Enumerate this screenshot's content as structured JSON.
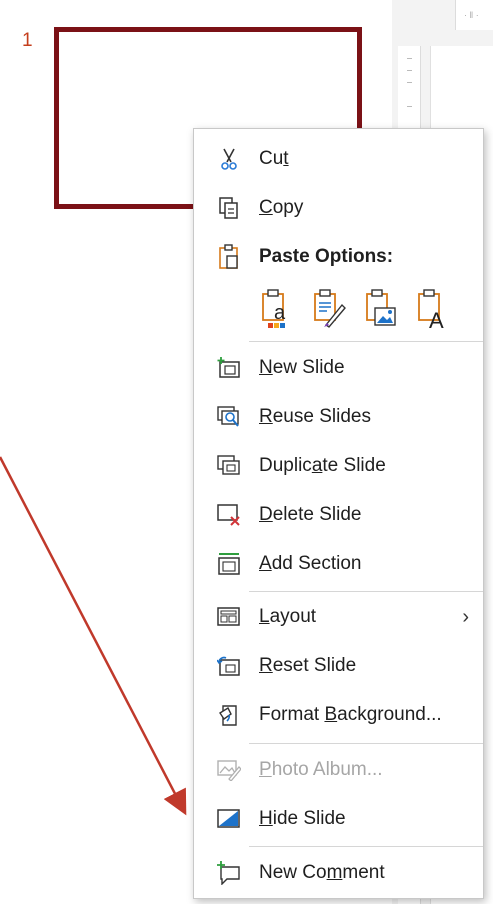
{
  "slide_pane": {
    "slide_number": "1"
  },
  "ruler": {
    "label": "· ‖ ·"
  },
  "menu": {
    "cut": {
      "pre": "Cu",
      "u": "t",
      "post": ""
    },
    "copy": {
      "pre": "",
      "u": "C",
      "post": "opy"
    },
    "paste_options": "Paste Options:",
    "paste_icons": [
      "paste-use-destination-theme-icon",
      "paste-keep-source-formatting-icon",
      "paste-picture-icon",
      "paste-keep-text-only-icon"
    ],
    "new_slide": {
      "pre": "",
      "u": "N",
      "post": "ew Slide"
    },
    "reuse_slides": {
      "pre": "",
      "u": "R",
      "post": "euse Slides"
    },
    "duplicate_slide": {
      "pre": "Duplic",
      "u": "a",
      "post": "te Slide"
    },
    "delete_slide": {
      "pre": "",
      "u": "D",
      "post": "elete Slide"
    },
    "add_section": {
      "pre": "",
      "u": "A",
      "post": "dd Section"
    },
    "layout": {
      "pre": "",
      "u": "L",
      "post": "ayout"
    },
    "reset_slide": {
      "pre": "",
      "u": "R",
      "post": "eset Slide"
    },
    "format_background": {
      "pre": "Format ",
      "u": "B",
      "post": "ackground..."
    },
    "photo_album": {
      "pre": "",
      "u": "P",
      "post": "hoto Album..."
    },
    "hide_slide": {
      "pre": "",
      "u": "H",
      "post": "ide Slide"
    },
    "new_comment": {
      "pre": "New Co",
      "u": "m",
      "post": "ment"
    }
  },
  "colors": {
    "accent_orange": "#c43e1c",
    "slide_border": "#7b1116",
    "arrow": "#c0392b"
  }
}
